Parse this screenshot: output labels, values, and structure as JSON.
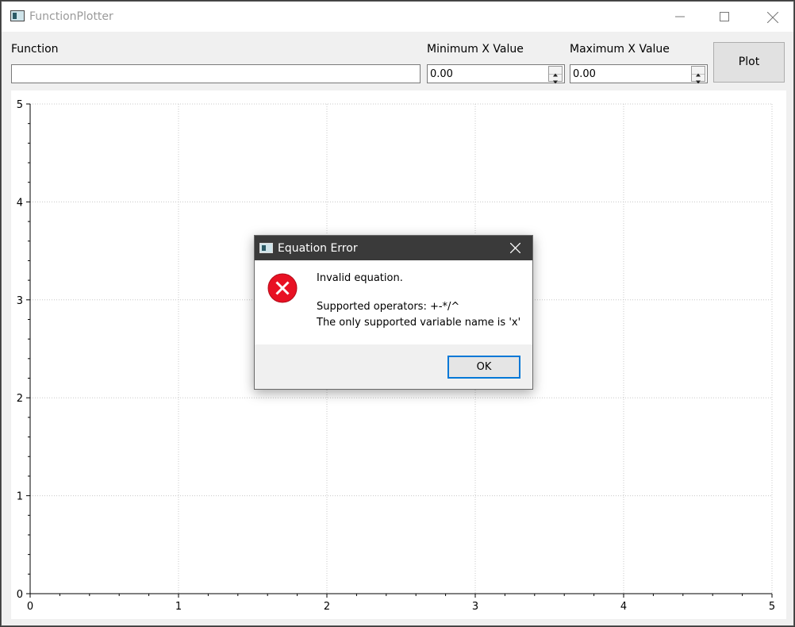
{
  "window": {
    "title": "FunctionPlotter",
    "controls": {
      "minimize_icon": "minimize-icon",
      "maximize_icon": "maximize-icon",
      "close_icon": "close-icon"
    }
  },
  "toolbar": {
    "function_label": "Function",
    "function_value": "",
    "min_x_label": "Minimum X Value",
    "min_x_value": "0.00",
    "max_x_label": "Maximum X Value",
    "max_x_value": "0.00",
    "plot_button": "Plot"
  },
  "chart_data": {
    "type": "line",
    "series": [],
    "xlim": [
      0,
      5
    ],
    "ylim": [
      0,
      5
    ],
    "x_ticks": [
      "0",
      "1",
      "2",
      "3",
      "4",
      "5"
    ],
    "y_ticks": [
      "0",
      "1",
      "2",
      "3",
      "4",
      "5"
    ],
    "grid": true,
    "grid_style": "dotted"
  },
  "dialog": {
    "title": "Equation Error",
    "icon": "error-icon",
    "message_line1": "Invalid equation.",
    "message_line2": "Supported operators: +-*/^",
    "message_line3": "The only supported variable name is 'x'",
    "ok_button": "OK",
    "accent": "#0078d7",
    "error_color": "#e81123"
  }
}
